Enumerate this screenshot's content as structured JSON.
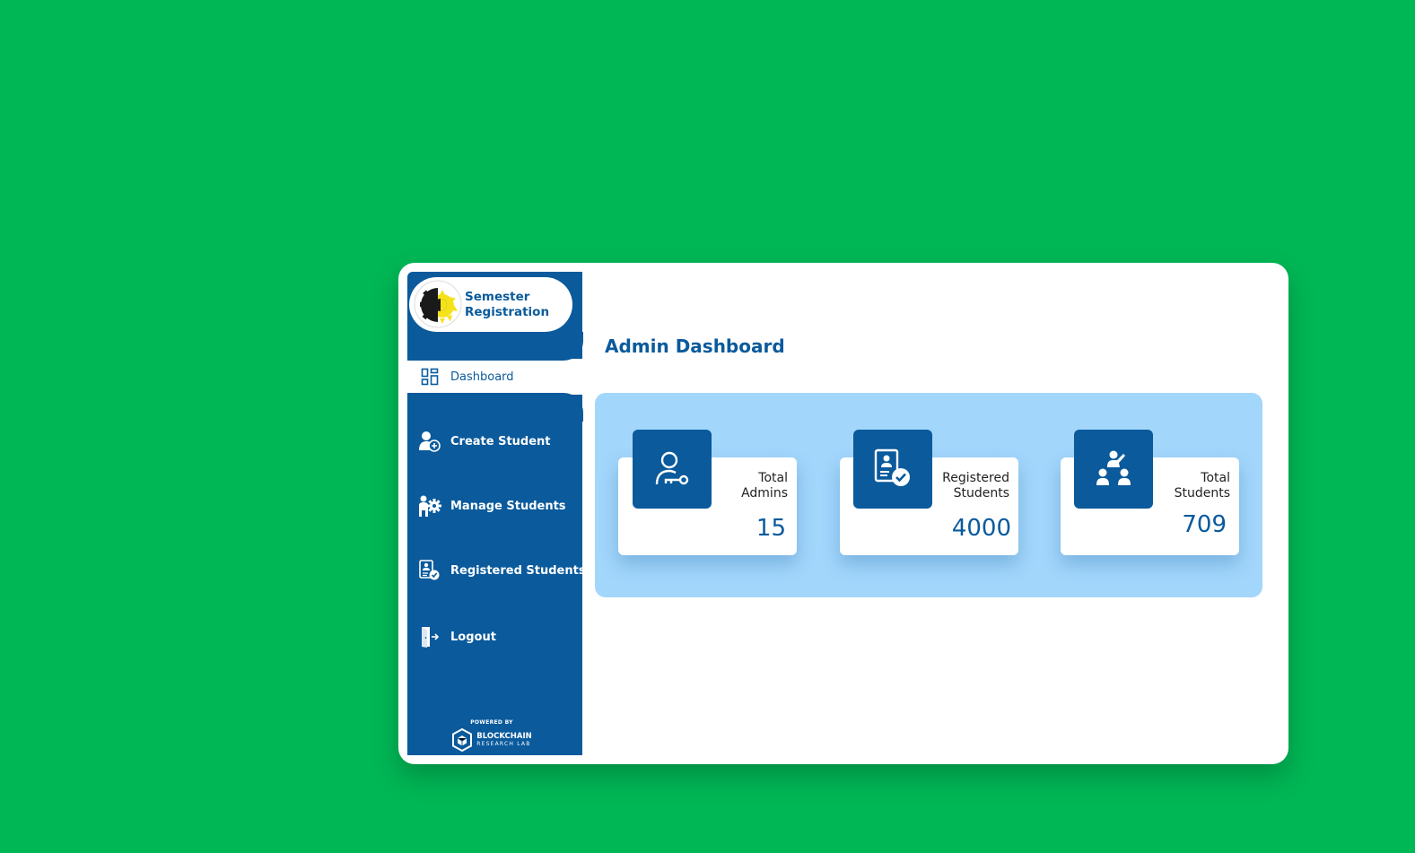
{
  "brand": {
    "line1": "Semester",
    "line2": "Registration",
    "logo": "university-seal-logo"
  },
  "sidebar": {
    "items": [
      {
        "label": "Dashboard",
        "icon": "dashboard-grid-icon",
        "active": true
      },
      {
        "label": "Create Student",
        "icon": "user-add-icon"
      },
      {
        "label": "Manage Students",
        "icon": "user-gear-icon"
      },
      {
        "label": "Registered Students",
        "icon": "id-check-icon"
      },
      {
        "label": "Logout",
        "icon": "logout-door-icon"
      }
    ],
    "powered_by": "POWERED BY",
    "partner_line1": "BLOCKCHAIN",
    "partner_line2": "RESEARCH LAB"
  },
  "main": {
    "title": "Admin Dashboard",
    "cards": [
      {
        "label_line1": "Total",
        "label_line2": "Admins",
        "value": "15",
        "icon": "admin-key-icon"
      },
      {
        "label_line1": "Registered",
        "label_line2": "Students",
        "value": "4000",
        "icon": "id-check-icon"
      },
      {
        "label_line1": "Total",
        "label_line2": "Students",
        "value": "709",
        "icon": "classroom-teacher-icon"
      }
    ]
  },
  "colors": {
    "background": "#00b755",
    "primary": "#0a5a9c",
    "panel": "#a3d6fb",
    "logo_accent": "#f6e21b"
  }
}
